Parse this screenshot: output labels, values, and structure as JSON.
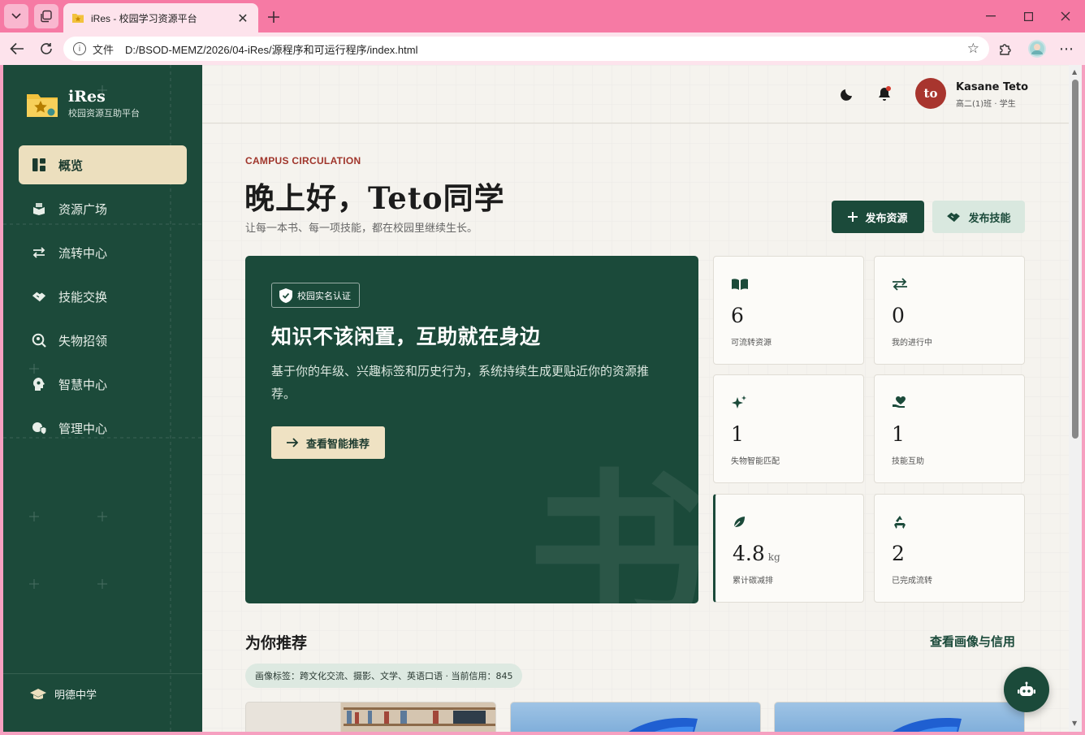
{
  "browser": {
    "tab_title": "iRes - 校园学习资源平台",
    "url_label": "文件",
    "url": "D:/BSOD-MEMZ/2026/04-iRes/源程序和可运行程序/index.html"
  },
  "sidebar": {
    "brand_name": "iRes",
    "brand_sub": "校园资源互助平台",
    "items": [
      {
        "label": "概览",
        "icon": "dashboard-icon",
        "active": true
      },
      {
        "label": "资源广场",
        "icon": "box-icon"
      },
      {
        "label": "流转中心",
        "icon": "transfer-icon"
      },
      {
        "label": "技能交换",
        "icon": "handshake-icon"
      },
      {
        "label": "失物招领",
        "icon": "search-location-icon"
      },
      {
        "label": "智慧中心",
        "icon": "brain-icon"
      },
      {
        "label": "管理中心",
        "icon": "admin-shield-icon"
      }
    ],
    "school": "明德中学"
  },
  "topbar": {
    "avatar_text": "to",
    "user_name": "Kasane Teto",
    "user_meta": "高二(1)班 · 学生"
  },
  "hero_header": {
    "eyebrow": "CAMPUS CIRCULATION",
    "greeting": "晚上好，Teto同学",
    "subline": "让每一本书、每一项技能，都在校园里继续生长。",
    "publish_resource": "发布资源",
    "publish_skill": "发布技能"
  },
  "hero": {
    "badge": "校园实名认证",
    "title": "知识不该闲置，互助就在身边",
    "desc": "基于你的年级、兴趣标签和历史行为，系统持续生成更贴近你的资源推荐。",
    "button": "查看智能推荐",
    "glyph": "书"
  },
  "stats": [
    {
      "value": "6",
      "label": "可流转资源",
      "icon": "book-open-icon"
    },
    {
      "value": "0",
      "label": "我的进行中",
      "icon": "arrows-icon"
    },
    {
      "value": "1",
      "label": "失物智能匹配",
      "icon": "sparkles-icon"
    },
    {
      "value": "1",
      "label": "技能互助",
      "icon": "hand-heart-icon"
    },
    {
      "value": "4.8",
      "unit": "kg",
      "label": "累计碳减排",
      "icon": "leaf-icon"
    },
    {
      "value": "2",
      "label": "已完成流转",
      "icon": "recycle-icon"
    }
  ],
  "recommend": {
    "title": "为你推荐",
    "link": "查看画像与信用",
    "tags": "画像标签：跨文化交流、摄影、文学、英语口语 · 当前信用：845"
  },
  "colors": {
    "primary": "#1b4a3a",
    "accent_cream": "#ecdfbe",
    "brand_red": "#a0352b",
    "chrome_pink": "#f67aa4"
  }
}
